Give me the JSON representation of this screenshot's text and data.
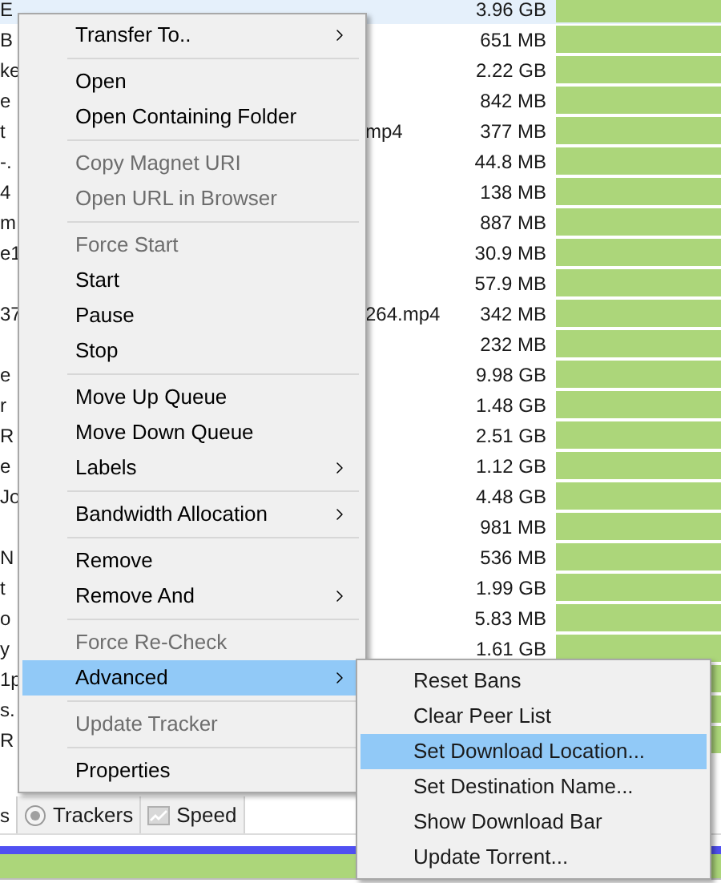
{
  "rows": [
    {
      "name": "E",
      "size": "3.96 GB",
      "level": 1,
      "selected": true
    },
    {
      "name": "B",
      "size": "651 MB",
      "level": 1,
      "selected": false
    },
    {
      "name": "ke",
      "size": "2.22 GB",
      "level": 1,
      "selected": false
    },
    {
      "name": "e",
      "size": "842 MB",
      "level": 1,
      "selected": false
    },
    {
      "name": "t",
      "tail": "mp4",
      "size": "377 MB",
      "level": 1,
      "selected": false
    },
    {
      "name": "-.",
      "size": "44.8 MB",
      "level": 1,
      "selected": false
    },
    {
      "name": "4",
      "size": "138 MB",
      "level": 1,
      "selected": false
    },
    {
      "name": "m",
      "size": "887 MB",
      "level": 1,
      "selected": false
    },
    {
      "name": "e1",
      "size": "30.9 MB",
      "level": 1,
      "selected": false
    },
    {
      "size": "57.9 MB",
      "level": 1,
      "selected": false
    },
    {
      "name": "37",
      "tail": "264.mp4",
      "size": "342 MB",
      "level": 1,
      "selected": false
    },
    {
      "size": "232 MB",
      "level": 1,
      "selected": false
    },
    {
      "name": "e",
      "size": "9.98 GB",
      "level": 1,
      "selected": false
    },
    {
      "name": "r",
      "size": "1.48 GB",
      "level": 1,
      "selected": false
    },
    {
      "name": "R",
      "size": "2.51 GB",
      "level": 1,
      "selected": false
    },
    {
      "name": "e",
      "size": "1.12 GB",
      "level": 1,
      "selected": false
    },
    {
      "name": "Jo",
      "size": "4.48 GB",
      "level": 1,
      "selected": false
    },
    {
      "size": "981 MB",
      "level": 1,
      "selected": false
    },
    {
      "name": "N",
      "size": "536 MB",
      "level": 1,
      "selected": false
    },
    {
      "name": "t",
      "size": "1.99 GB",
      "level": 1,
      "selected": false
    },
    {
      "name": "o",
      "size": "5.83 MB",
      "level": 1,
      "selected": false
    },
    {
      "name": "y",
      "size": "1.61 GB",
      "level": 1,
      "selected": false
    },
    {
      "name": "1p",
      "level": 1,
      "selected": false
    },
    {
      "name": "s.",
      "level": 1,
      "selected": false
    },
    {
      "name": "R",
      "level": 1,
      "selected": false
    }
  ],
  "context_menu": {
    "items": [
      {
        "kind": "item",
        "label": "Transfer To..",
        "disabled": false,
        "selected": false,
        "submenu": true
      },
      {
        "kind": "separator"
      },
      {
        "kind": "item",
        "label": "Open",
        "disabled": false,
        "selected": false,
        "submenu": false
      },
      {
        "kind": "item",
        "label": "Open Containing Folder",
        "disabled": false,
        "selected": false,
        "submenu": false
      },
      {
        "kind": "separator"
      },
      {
        "kind": "item",
        "label": "Copy Magnet URI",
        "disabled": true,
        "selected": false,
        "submenu": false
      },
      {
        "kind": "item",
        "label": "Open URL in Browser",
        "disabled": true,
        "selected": false,
        "submenu": false
      },
      {
        "kind": "separator"
      },
      {
        "kind": "item",
        "label": "Force Start",
        "disabled": true,
        "selected": false,
        "submenu": false
      },
      {
        "kind": "item",
        "label": "Start",
        "disabled": false,
        "selected": false,
        "submenu": false
      },
      {
        "kind": "item",
        "label": "Pause",
        "disabled": false,
        "selected": false,
        "submenu": false
      },
      {
        "kind": "item",
        "label": "Stop",
        "disabled": false,
        "selected": false,
        "submenu": false
      },
      {
        "kind": "separator"
      },
      {
        "kind": "item",
        "label": "Move Up Queue",
        "disabled": false,
        "selected": false,
        "submenu": false
      },
      {
        "kind": "item",
        "label": "Move Down Queue",
        "disabled": false,
        "selected": false,
        "submenu": false
      },
      {
        "kind": "item",
        "label": "Labels",
        "disabled": false,
        "selected": false,
        "submenu": true
      },
      {
        "kind": "separator"
      },
      {
        "kind": "item",
        "label": "Bandwidth Allocation",
        "disabled": false,
        "selected": false,
        "submenu": true
      },
      {
        "kind": "separator"
      },
      {
        "kind": "item",
        "label": "Remove",
        "disabled": false,
        "selected": false,
        "submenu": false
      },
      {
        "kind": "item",
        "label": "Remove And",
        "disabled": false,
        "selected": false,
        "submenu": true
      },
      {
        "kind": "separator"
      },
      {
        "kind": "item",
        "label": "Force Re-Check",
        "disabled": true,
        "selected": false,
        "submenu": false
      },
      {
        "kind": "item",
        "label": "Advanced",
        "disabled": false,
        "selected": true,
        "submenu": true
      },
      {
        "kind": "separator"
      },
      {
        "kind": "item",
        "label": "Update Tracker",
        "disabled": true,
        "selected": false,
        "submenu": false
      },
      {
        "kind": "separator"
      },
      {
        "kind": "item",
        "label": "Properties",
        "disabled": false,
        "selected": false,
        "submenu": false
      }
    ]
  },
  "advanced_submenu": {
    "items": [
      {
        "label": "Reset Bans",
        "selected": false
      },
      {
        "label": "Clear Peer List",
        "selected": false
      },
      {
        "label": "Set Download Location...",
        "selected": true
      },
      {
        "label": "Set Destination Name...",
        "selected": false
      },
      {
        "label": "Show Download Bar",
        "selected": false
      },
      {
        "label": "Update Torrent...",
        "selected": false
      }
    ]
  },
  "tabs": [
    {
      "label": "s",
      "kind": "text"
    },
    {
      "label": "Trackers",
      "kind": "radio"
    },
    {
      "label": "Speed",
      "kind": "chart"
    }
  ],
  "download_bar": {
    "level": 1
  }
}
